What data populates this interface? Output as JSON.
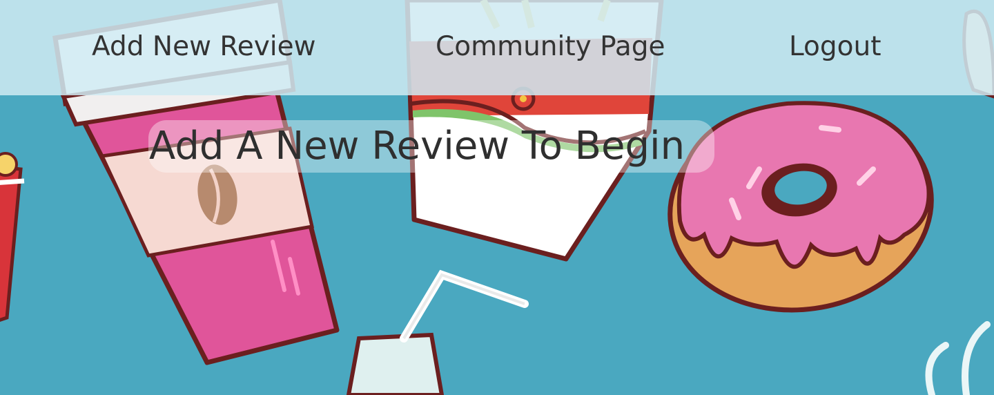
{
  "nav": {
    "add_review": "Add New Review",
    "community": "Community Page",
    "logout": "Logout"
  },
  "main": {
    "heading": "Add A New Review To Begin"
  },
  "colors": {
    "background": "#4aa8c0",
    "navbar": "#cfeaf2",
    "text": "#333333",
    "cup_pink": "#e0559a",
    "donut_icing": "#e877b0",
    "fries_red": "#e0453a",
    "outline": "#6b1f1f"
  },
  "background_art": [
    "coffee-cup-illustration",
    "fries-box-illustration",
    "donut-illustration",
    "milk-bottle-illustration",
    "popcorn-illustration"
  ]
}
